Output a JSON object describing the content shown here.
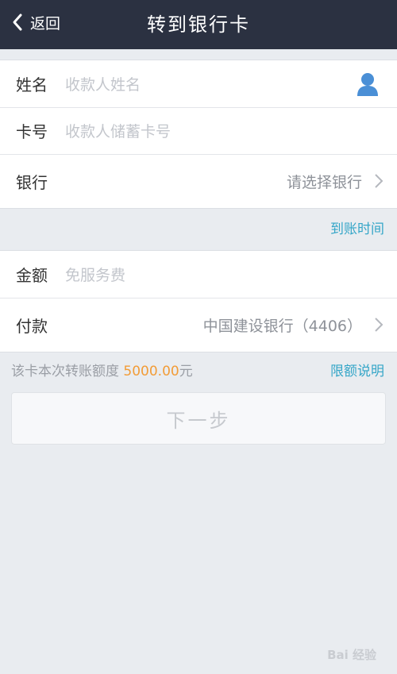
{
  "navbar": {
    "back_label": "返回",
    "title": "转到银行卡"
  },
  "recipient": {
    "name_label": "姓名",
    "name_placeholder": "收款人姓名",
    "card_label": "卡号",
    "card_placeholder": "收款人储蓄卡号",
    "bank_label": "银行",
    "bank_value": "请选择银行"
  },
  "arrival_time_link": "到账时间",
  "payment": {
    "amount_label": "金额",
    "amount_placeholder": "免服务费",
    "pay_label": "付款",
    "pay_value": "中国建设银行（4406）"
  },
  "limit": {
    "prefix": "该卡本次转账额度",
    "amount": "5000.00",
    "suffix": "元",
    "link": "限额说明"
  },
  "next_button": "下一步",
  "colors": {
    "navbar_bg": "#2b3141",
    "accent_link": "#35a6c8",
    "amount_orange": "#f29c37",
    "contact_icon": "#4a8fd6"
  },
  "icons": {
    "back": "chevron-left-icon",
    "contact": "contact-person-icon",
    "chevron": "chevron-right-icon"
  },
  "watermark": "Bai 经验"
}
